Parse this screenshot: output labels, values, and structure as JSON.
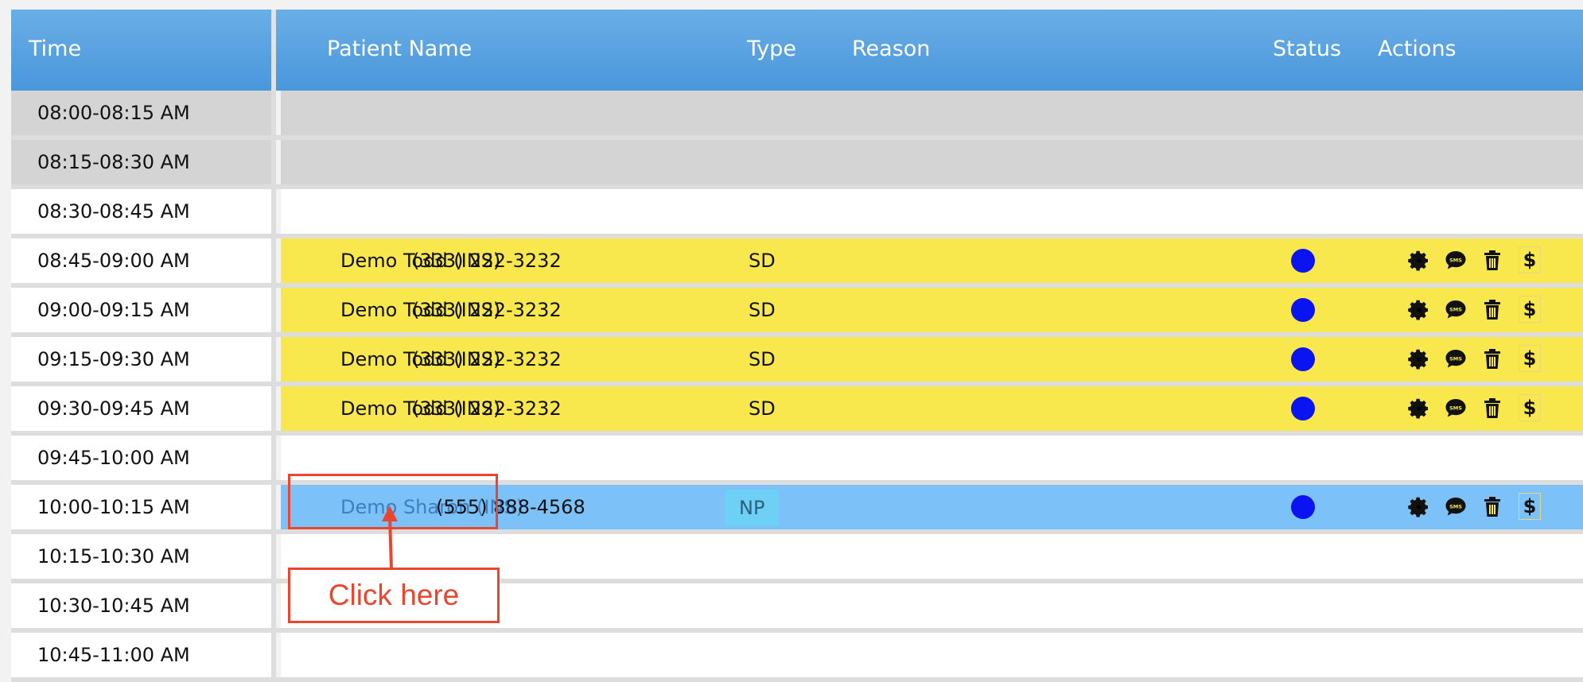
{
  "header": {
    "time": "Time",
    "patient_name": "Patient Name",
    "type": "Type",
    "reason": "Reason",
    "status": "Status",
    "actions": "Actions"
  },
  "rows": [
    {
      "time": "08:00-08:15 AM",
      "style": "grey"
    },
    {
      "time": "08:15-08:30 AM",
      "style": "grey"
    },
    {
      "time": "08:30-08:45 AM",
      "style": "white"
    },
    {
      "time": "08:45-09:00 AM",
      "style": "yellow",
      "patient": "Demo Todd (INS)",
      "phone": "(333) 222-3232",
      "type": "SD"
    },
    {
      "time": "09:00-09:15 AM",
      "style": "yellow",
      "patient": "Demo Todd (INS)",
      "phone": "(333) 222-3232",
      "type": "SD"
    },
    {
      "time": "09:15-09:30 AM",
      "style": "yellow",
      "patient": "Demo Todd (INS)",
      "phone": "(333) 222-3232",
      "type": "SD"
    },
    {
      "time": "09:30-09:45 AM",
      "style": "yellow",
      "patient": "Demo Todd (INS)",
      "phone": "(333) 222-3232",
      "type": "SD"
    },
    {
      "time": "09:45-10:00 AM",
      "style": "white"
    },
    {
      "time": "10:00-10:15 AM",
      "style": "blue",
      "patient": "Demo Sharon (INS)",
      "phone": "(555) 888-4568",
      "type": "NP"
    },
    {
      "time": "10:15-10:30 AM",
      "style": "white"
    },
    {
      "time": "10:30-10:45 AM",
      "style": "white"
    },
    {
      "time": "10:45-11:00 AM",
      "style": "white"
    }
  ],
  "actions": {
    "dollar_label": "$",
    "sms_label": "SMS"
  },
  "annotation": {
    "callout_text": "Click here"
  },
  "colors": {
    "header": "#4a97dc",
    "booked_row": "#f8e84e",
    "selected_row": "#7cc1f7",
    "status_dot": "#0a14f0",
    "annotation": "#e8462e"
  }
}
